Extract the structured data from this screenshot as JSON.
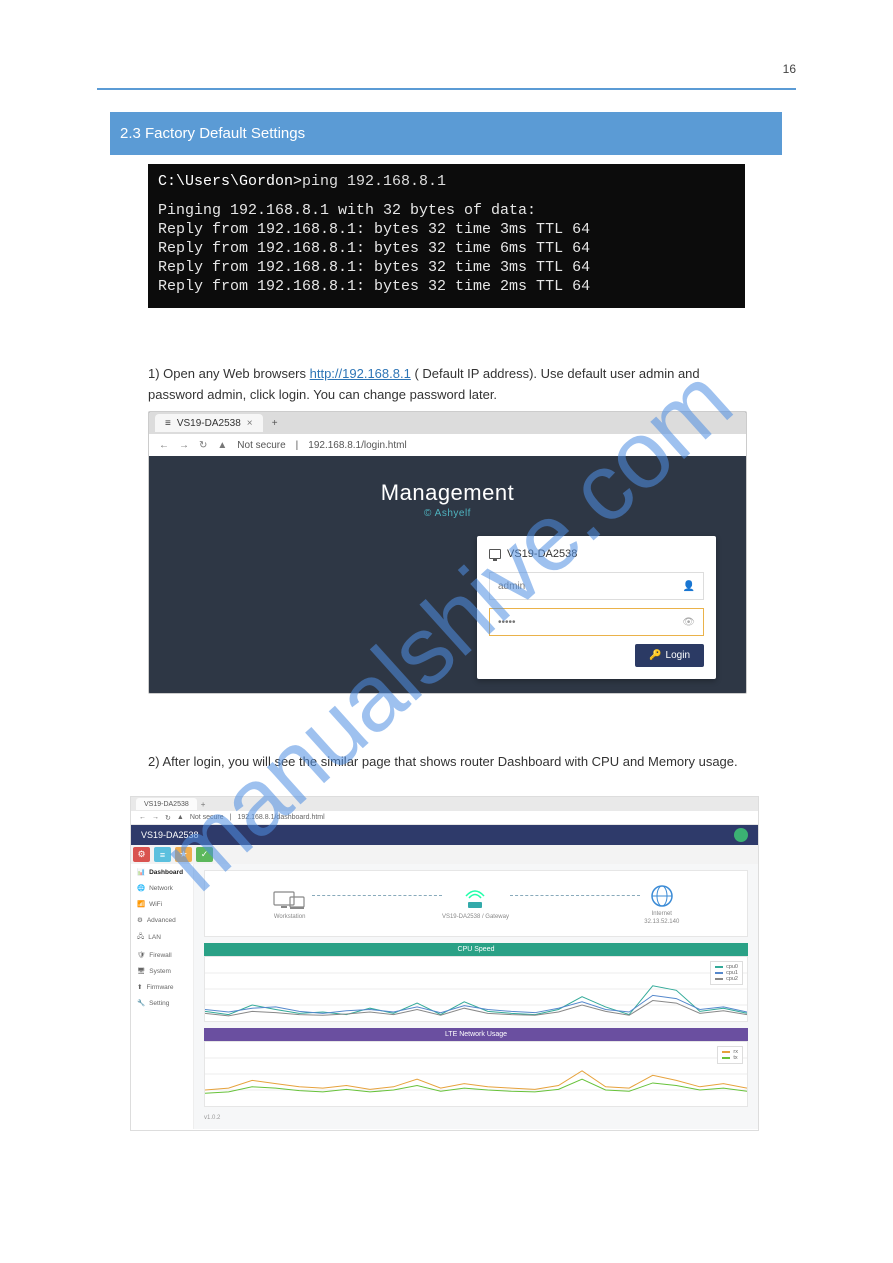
{
  "page_number": "16",
  "section_title": "2.3 Factory Default Settings",
  "terminal": {
    "prompt": "C:\\Users\\Gordon>",
    "command": "ping 192.168.8.1",
    "header": "Pinging 192.168.8.1 with 32 bytes of data:",
    "replies": [
      "Reply from 192.168.8.1: bytes 32 time 3ms TTL 64",
      "Reply from 192.168.8.1: bytes 32 time 6ms TTL 64",
      "Reply from 192.168.8.1: bytes 32 time 3ms TTL 64",
      "Reply from 192.168.8.1: bytes 32 time 2ms TTL 64"
    ]
  },
  "para1_prefix": "1) Open any Web browsers ",
  "para1_url_text": "http://192.168.8.1",
  "para1_suffix": " ( Default IP address). Use default user admin and password admin, click login. You can change password later.",
  "screenshot1": {
    "tab_title": "VS19-DA2538",
    "addr_label": "Not secure",
    "url": "192.168.8.1/login.html",
    "brand": "Management",
    "brand_sub": "© Ashyelf",
    "device_name": "VS19-DA2538",
    "username_value": "admin",
    "password_masked": "•••••",
    "login_label": "Login",
    "user_icon": "👤",
    "eye_icon": "👁",
    "key_icon": "🔑"
  },
  "para2": "2) After login, you will see the similar page that shows router Dashboard with CPU and Memory usage.",
  "screenshot2": {
    "tab_title": "VS19-DA2538",
    "addr_label": "Not secure",
    "url": "192.168.8.1/dashboard.html",
    "titlebar": "VS19-DA2538",
    "user_avatar": "●",
    "quick_colors": [
      "#d9534f",
      "#5bc0de",
      "#f0ad4e",
      "#5cb85c"
    ],
    "menu": [
      "Dashboard",
      "Network",
      "WiFi",
      "Advanced",
      "LAN",
      "Firewall",
      "System",
      "Firmware",
      "Setting"
    ],
    "topo": {
      "node1_label": "Workstation",
      "node2_label": "VS19-DA2538 / Gateway",
      "node3_label_l1": "Internet",
      "node3_label_l2": "32.13.52.140"
    },
    "panel1_title": "CPU Speed",
    "panel1_legend": [
      "cpu0",
      "cpu1",
      "cpu2"
    ],
    "panel1_colors": [
      "#3a9",
      "#58c",
      "#888"
    ],
    "panel2_title": "LTE Network Usage",
    "panel2_legend": [
      "rx",
      "tx"
    ],
    "panel2_colors": [
      "#e6a23c",
      "#67c23a"
    ],
    "footer": "v1.0.2"
  },
  "watermark": "manualshive.com",
  "chart_data": [
    {
      "type": "line",
      "title": "CPU Speed",
      "x": [
        0,
        1,
        2,
        3,
        4,
        5,
        6,
        7,
        8,
        9,
        10,
        11,
        12,
        13,
        14,
        15,
        16,
        17,
        18,
        19,
        20,
        21,
        22,
        23
      ],
      "series": [
        {
          "name": "cpu0",
          "values": [
            15,
            10,
            25,
            18,
            12,
            14,
            10,
            20,
            12,
            28,
            10,
            30,
            15,
            12,
            10,
            18,
            38,
            22,
            10,
            55,
            48,
            15,
            20,
            12
          ]
        },
        {
          "name": "cpu1",
          "values": [
            18,
            14,
            20,
            22,
            15,
            12,
            16,
            18,
            14,
            22,
            13,
            24,
            18,
            15,
            13,
            20,
            30,
            18,
            14,
            40,
            35,
            18,
            22,
            14
          ]
        },
        {
          "name": "cpu2",
          "values": [
            12,
            8,
            15,
            13,
            10,
            9,
            11,
            14,
            10,
            18,
            9,
            20,
            12,
            10,
            9,
            14,
            25,
            15,
            9,
            32,
            28,
            12,
            16,
            10
          ]
        }
      ],
      "ylim": [
        0,
        100
      ]
    },
    {
      "type": "line",
      "title": "LTE Network Usage",
      "x": [
        0,
        1,
        2,
        3,
        4,
        5,
        6,
        7,
        8,
        9,
        10,
        11,
        12,
        13,
        14,
        15,
        16,
        17,
        18,
        19,
        20,
        21,
        22,
        23
      ],
      "series": [
        {
          "name": "rx",
          "values": [
            25,
            28,
            40,
            35,
            30,
            28,
            32,
            26,
            30,
            42,
            28,
            35,
            30,
            28,
            26,
            32,
            55,
            30,
            28,
            48,
            40,
            30,
            35,
            28
          ]
        },
        {
          "name": "tx",
          "values": [
            20,
            22,
            30,
            28,
            24,
            22,
            26,
            22,
            25,
            32,
            23,
            28,
            25,
            23,
            22,
            26,
            42,
            25,
            23,
            36,
            32,
            25,
            28,
            23
          ]
        }
      ],
      "ylim": [
        0,
        100
      ]
    }
  ]
}
